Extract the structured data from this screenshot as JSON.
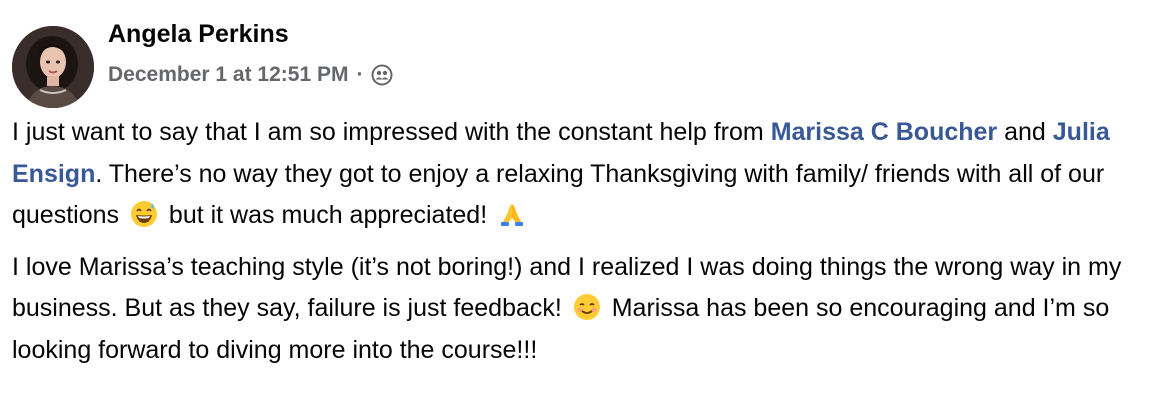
{
  "post": {
    "author": "Angela Perkins",
    "timestamp": "December 1 at 12:51 PM",
    "separator": "·",
    "audience_icon": "friends-icon",
    "paragraph1": {
      "intro": "I just want to say that I am so impressed with the constant help from ",
      "mention1": "Marissa C Boucher",
      "and": " and ",
      "mention2": "Julia Ensign",
      "middle": ". There’s no way they got to enjoy a relaxing Thanksgiving with family/ friends with all of our questions ",
      "emoji1": "grinning-sweat-emoji",
      "end": " but it was much appreciated! ",
      "emoji2": "folded-hands-emoji"
    },
    "paragraph2": {
      "intro": "I love Marissa’s teaching style (it’s not boring!) and I realized I was doing things the wrong way in my business. But as they say, failure is just feedback! ",
      "emoji": "smiling-face-emoji",
      "end": " Marissa has been so encouraging and I’m so looking forward to diving more into the course!!!"
    },
    "colors": {
      "mention": "#385898",
      "meta": "#65676b",
      "text": "#050505"
    }
  }
}
